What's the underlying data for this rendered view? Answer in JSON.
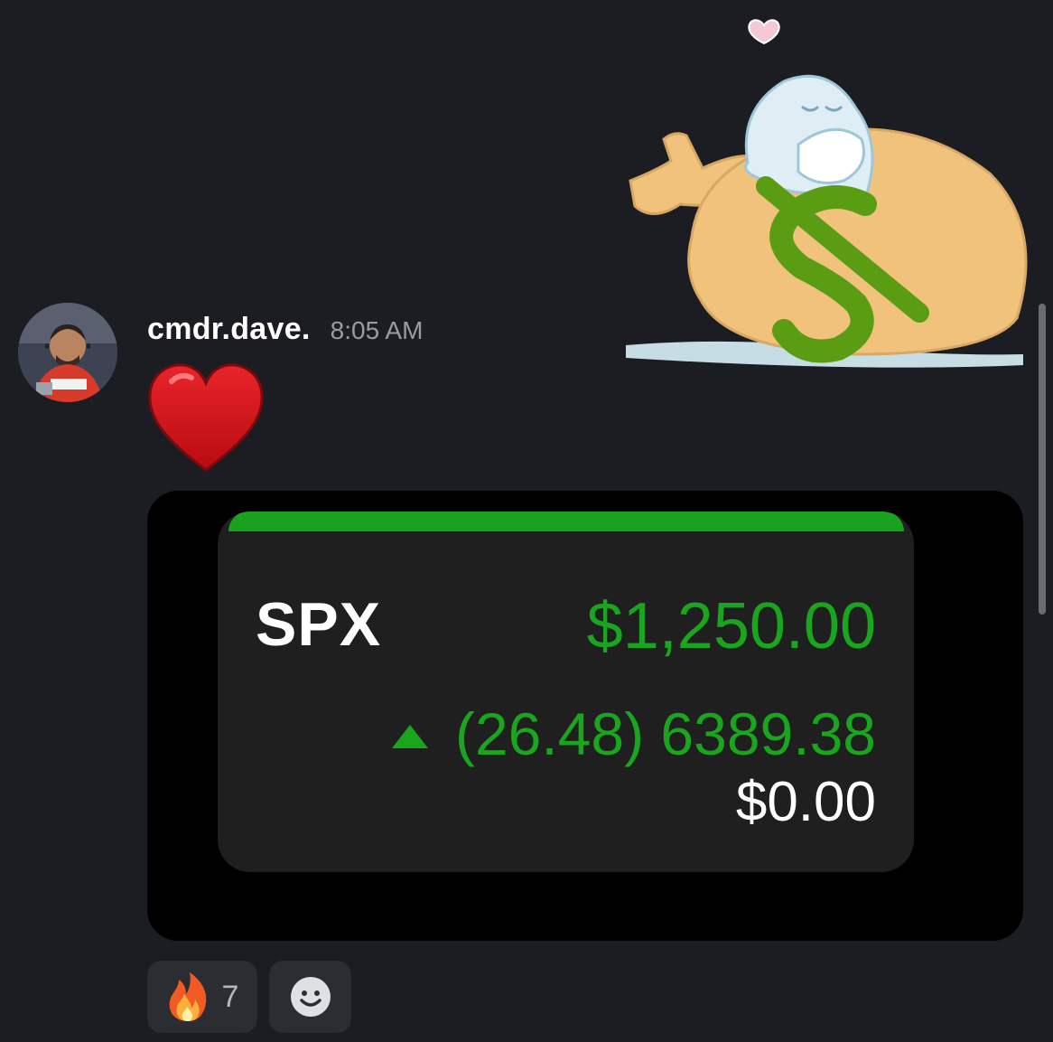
{
  "message": {
    "username": "cmdr.dave.",
    "timestamp": "8:05 AM"
  },
  "sticker": {
    "icon": "money-bag-sleeping-ghost-sticker"
  },
  "emoji": {
    "icon": "red-heart"
  },
  "embed": {
    "ticker": "SPX",
    "price": "$1,250.00",
    "change": "(26.48) 6389.38",
    "direction": "up",
    "value": "$0.00",
    "accent_color": "#19a21e"
  },
  "reactions": [
    {
      "icon": "fire",
      "count": "7"
    },
    {
      "icon": "add-reaction-smiley"
    }
  ]
}
